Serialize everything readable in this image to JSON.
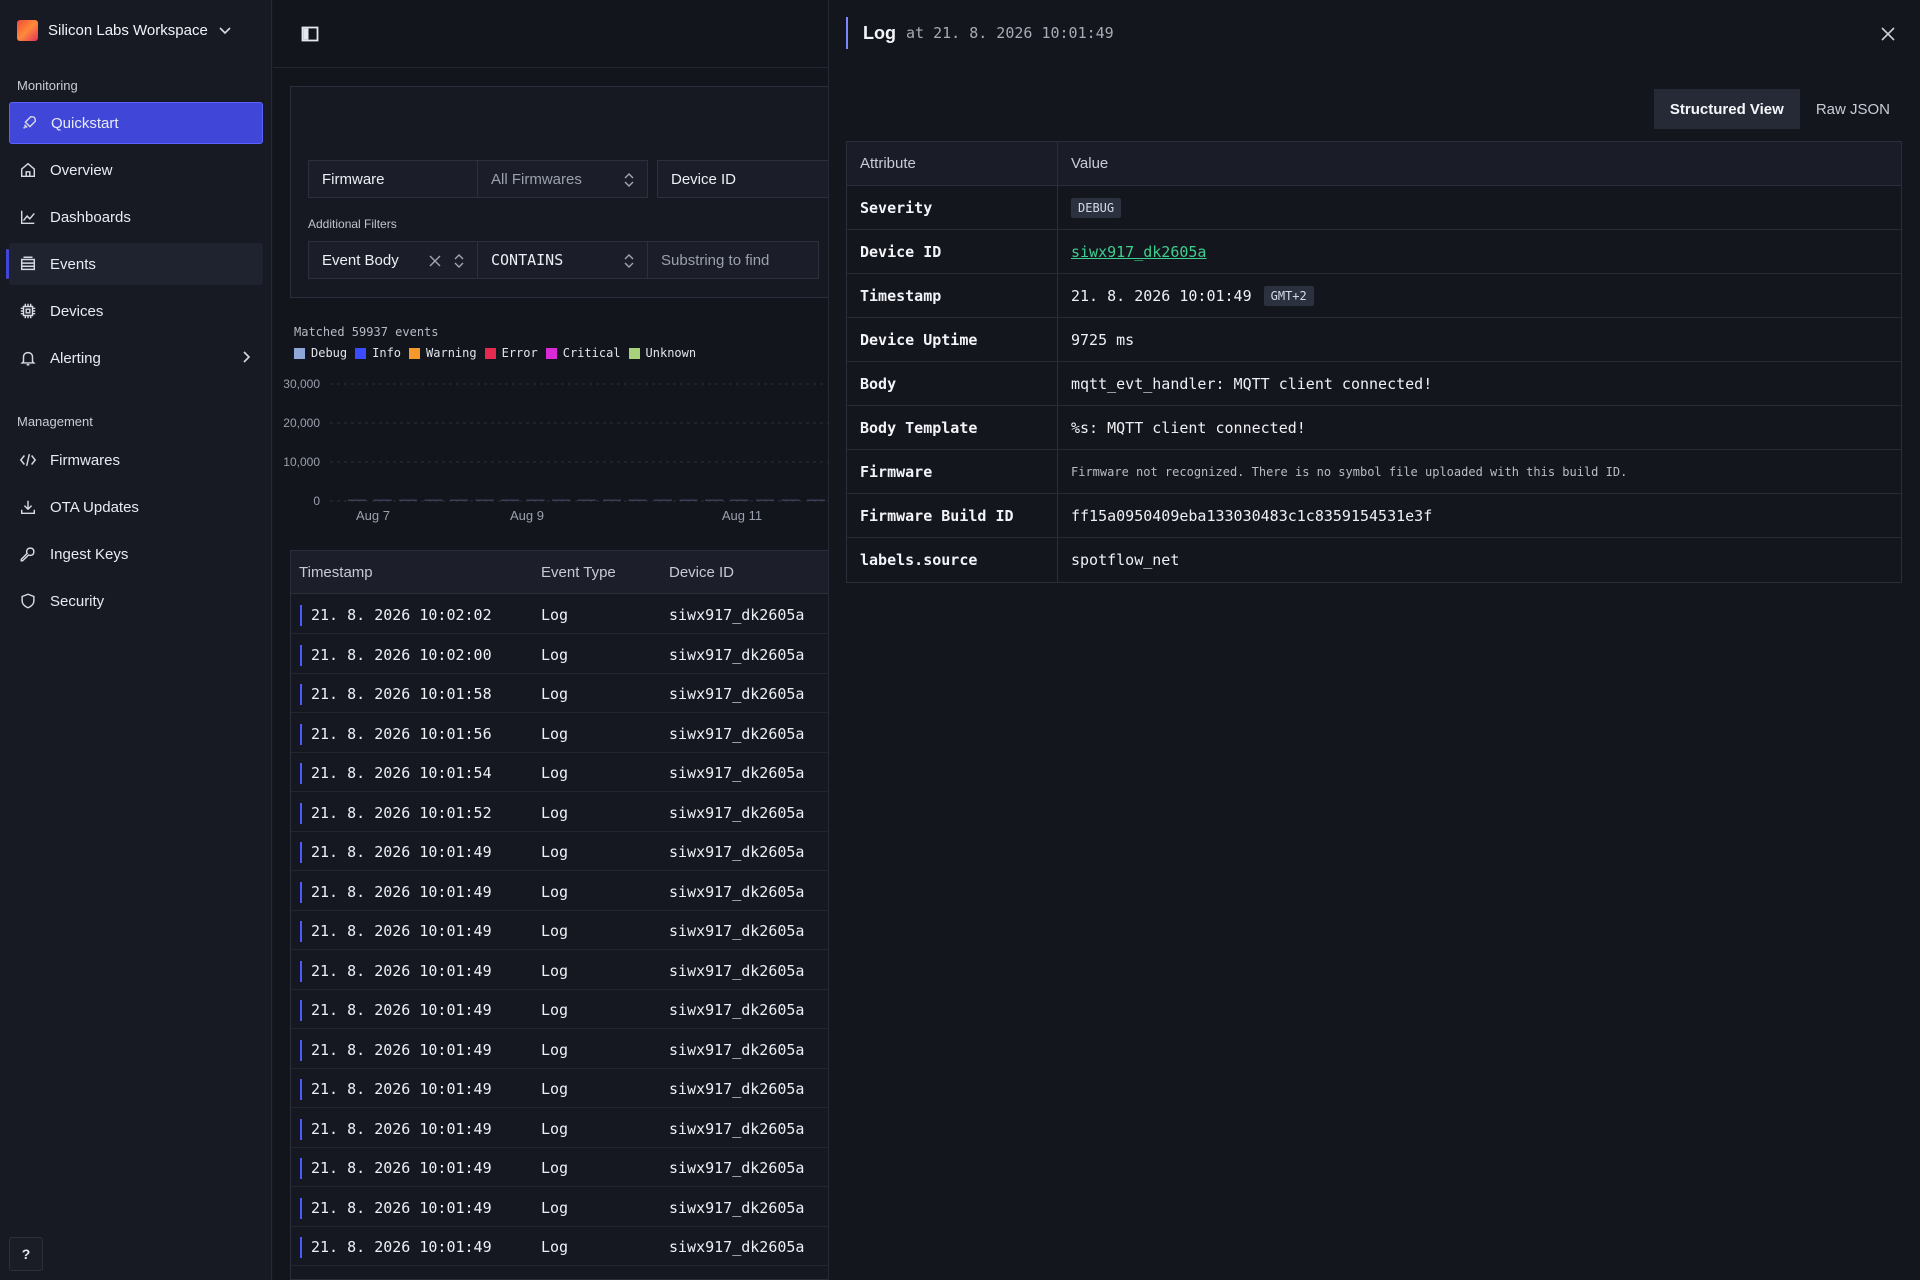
{
  "workspace": {
    "name": "Silicon Labs Workspace"
  },
  "sidebar": {
    "monitoring_label": "Monitoring",
    "management_label": "Management",
    "monitoring_items": [
      {
        "label": "Quickstart",
        "icon": "rocket-icon"
      },
      {
        "label": "Overview",
        "icon": "home-icon"
      },
      {
        "label": "Dashboards",
        "icon": "chart-line-icon"
      },
      {
        "label": "Events",
        "icon": "events-icon"
      },
      {
        "label": "Devices",
        "icon": "chip-icon"
      },
      {
        "label": "Alerting",
        "icon": "bell-icon"
      }
    ],
    "management_items": [
      {
        "label": "Firmwares",
        "icon": "code-icon"
      },
      {
        "label": "OTA Updates",
        "icon": "download-icon"
      },
      {
        "label": "Ingest Keys",
        "icon": "key-icon"
      },
      {
        "label": "Security",
        "icon": "shield-icon"
      }
    ],
    "help_label": "?"
  },
  "filters": {
    "firmware_label": "Firmware",
    "firmware_value": "All Firmwares",
    "device_id_label": "Device ID",
    "additional_label": "Additional Filters",
    "field": "Event Body",
    "operator": "CONTAINS",
    "value_placeholder": "Substring to find"
  },
  "summary": {
    "matched": "Matched 59937 events"
  },
  "legend": [
    {
      "label": "Debug",
      "color": "#8fa6d8"
    },
    {
      "label": "Info",
      "color": "#3b4cff"
    },
    {
      "label": "Warning",
      "color": "#f59a2a"
    },
    {
      "label": "Error",
      "color": "#e5294f"
    },
    {
      "label": "Critical",
      "color": "#d92ad9"
    },
    {
      "label": "Unknown",
      "color": "#a8d27a"
    }
  ],
  "chart_data": {
    "type": "bar",
    "y_ticks": [
      "30,000",
      "20,000",
      "10,000",
      "0"
    ],
    "x_ticks": [
      "Aug 7",
      "Aug 9",
      "Aug 11"
    ],
    "ylim": [
      0,
      30000
    ]
  },
  "events_table": {
    "headers": [
      "Timestamp",
      "Event Type",
      "Device ID"
    ],
    "rows": [
      [
        "21. 8. 2026 10:02:02",
        "Log",
        "siwx917_dk2605a"
      ],
      [
        "21. 8. 2026 10:02:00",
        "Log",
        "siwx917_dk2605a"
      ],
      [
        "21. 8. 2026 10:01:58",
        "Log",
        "siwx917_dk2605a"
      ],
      [
        "21. 8. 2026 10:01:56",
        "Log",
        "siwx917_dk2605a"
      ],
      [
        "21. 8. 2026 10:01:54",
        "Log",
        "siwx917_dk2605a"
      ],
      [
        "21. 8. 2026 10:01:52",
        "Log",
        "siwx917_dk2605a"
      ],
      [
        "21. 8. 2026 10:01:49",
        "Log",
        "siwx917_dk2605a"
      ],
      [
        "21. 8. 2026 10:01:49",
        "Log",
        "siwx917_dk2605a"
      ],
      [
        "21. 8. 2026 10:01:49",
        "Log",
        "siwx917_dk2605a"
      ],
      [
        "21. 8. 2026 10:01:49",
        "Log",
        "siwx917_dk2605a"
      ],
      [
        "21. 8. 2026 10:01:49",
        "Log",
        "siwx917_dk2605a"
      ],
      [
        "21. 8. 2026 10:01:49",
        "Log",
        "siwx917_dk2605a"
      ],
      [
        "21. 8. 2026 10:01:49",
        "Log",
        "siwx917_dk2605a"
      ],
      [
        "21. 8. 2026 10:01:49",
        "Log",
        "siwx917_dk2605a"
      ],
      [
        "21. 8. 2026 10:01:49",
        "Log",
        "siwx917_dk2605a"
      ],
      [
        "21. 8. 2026 10:01:49",
        "Log",
        "siwx917_dk2605a"
      ],
      [
        "21. 8. 2026 10:01:49",
        "Log",
        "siwx917_dk2605a"
      ]
    ]
  },
  "detail": {
    "title": "Log",
    "subtitle": "at 21. 8. 2026 10:01:49",
    "view_structured": "Structured View",
    "view_raw": "Raw JSON",
    "col_attribute": "Attribute",
    "col_value": "Value",
    "severity_label": "Severity",
    "severity_value": "DEBUG",
    "device_id_label": "Device ID",
    "device_id_value": "siwx917_dk2605a",
    "timestamp_label": "Timestamp",
    "timestamp_value": "21. 8. 2026 10:01:49",
    "timezone": "GMT+2",
    "uptime_label": "Device Uptime",
    "uptime_value": "9725 ms",
    "body_label": "Body",
    "body_value": "mqtt_evt_handler: MQTT client connected!",
    "template_label": "Body Template",
    "template_value": "%s: MQTT client connected!",
    "firmware_label": "Firmware",
    "firmware_value": "Firmware not recognized. There is no symbol file uploaded with this build ID.",
    "build_label": "Firmware Build ID",
    "build_value": "ff15a0950409eba133030483c1c8359154531e3f",
    "source_label": "labels.source",
    "source_value": "spotflow_net"
  }
}
